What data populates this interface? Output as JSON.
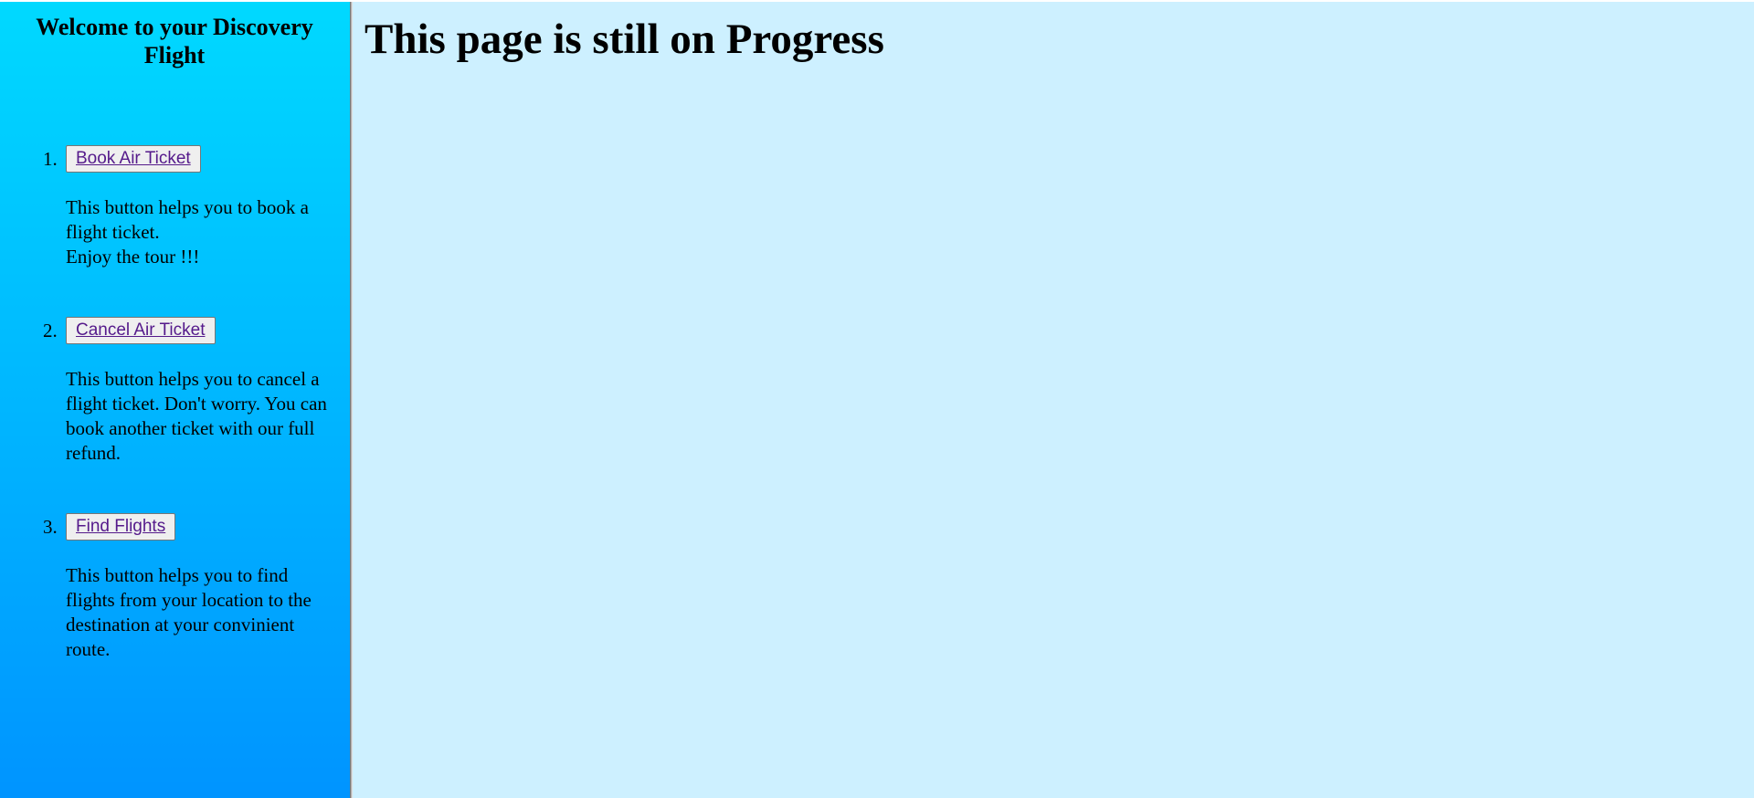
{
  "sidebar": {
    "heading": "Welcome to your Discovery Flight",
    "items": [
      {
        "number": "1.",
        "button_label": "Book Air Ticket",
        "description": "This button helps you to book a flight ticket.\nEnjoy the tour !!!"
      },
      {
        "number": "2.",
        "button_label": "Cancel Air Ticket",
        "description": "This button helps you to cancel a flight ticket. Don't worry. You can book another ticket with our full refund."
      },
      {
        "number": "3.",
        "button_label": "Find Flights",
        "description": "This button helps you to find flights from your location to the destination at your convinient route."
      }
    ]
  },
  "main": {
    "title": "This page is still on Progress"
  },
  "colors": {
    "sidebar_gradient_top": "#00d9ff",
    "sidebar_gradient_bottom": "#0094ff",
    "main_background": "#cdf0ff",
    "visited_link": "#551a8b"
  }
}
